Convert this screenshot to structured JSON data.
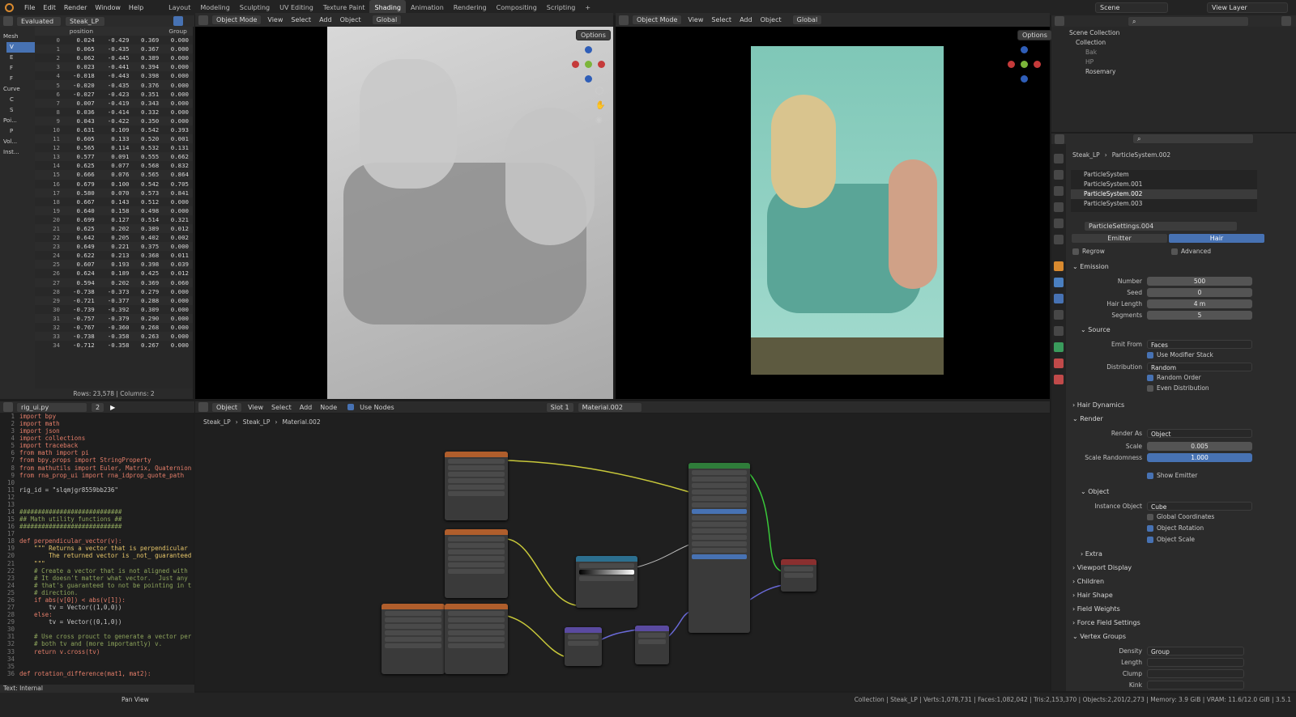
{
  "menu": [
    "File",
    "Edit",
    "Render",
    "Window",
    "Help"
  ],
  "workspaces": [
    "Layout",
    "Modeling",
    "Sculpting",
    "UV Editing",
    "Texture Paint",
    "Shading",
    "Animation",
    "Rendering",
    "Compositing",
    "Scripting",
    "+"
  ],
  "active_workspace": "Shading",
  "scene": "Scene",
  "view_layer": "View Layer",
  "spreadsheet": {
    "mode": "Evaluated",
    "object": "Steak_LP",
    "sidebar": [
      "Mesh",
      "V",
      "E",
      "F",
      "F",
      "Curve",
      "C",
      "S",
      "Poi...",
      "P",
      "Vol...",
      "Inst..."
    ],
    "columns": [
      "",
      "position",
      "",
      "",
      "Group"
    ],
    "rows": [
      [
        "0",
        "0.024",
        "-0.429",
        "0.369",
        "0.000"
      ],
      [
        "1",
        "0.065",
        "-0.435",
        "0.367",
        "0.000"
      ],
      [
        "2",
        "0.062",
        "-0.445",
        "0.389",
        "0.000"
      ],
      [
        "3",
        "0.023",
        "-0.441",
        "0.394",
        "0.000"
      ],
      [
        "4",
        "-0.018",
        "-0.443",
        "0.398",
        "0.000"
      ],
      [
        "5",
        "-0.020",
        "-0.435",
        "0.376",
        "0.000"
      ],
      [
        "6",
        "-0.027",
        "-0.423",
        "0.351",
        "0.000"
      ],
      [
        "7",
        "0.007",
        "-0.419",
        "0.343",
        "0.000"
      ],
      [
        "8",
        "0.036",
        "-0.414",
        "0.332",
        "0.000"
      ],
      [
        "9",
        "0.043",
        "-0.422",
        "0.350",
        "0.000"
      ],
      [
        "10",
        "0.631",
        "0.109",
        "0.542",
        "0.393"
      ],
      [
        "11",
        "0.605",
        "0.133",
        "0.520",
        "0.001"
      ],
      [
        "12",
        "0.565",
        "0.114",
        "0.532",
        "0.131"
      ],
      [
        "13",
        "0.577",
        "0.091",
        "0.555",
        "0.662"
      ],
      [
        "14",
        "0.625",
        "0.077",
        "0.568",
        "0.832"
      ],
      [
        "15",
        "0.666",
        "0.076",
        "0.565",
        "0.864"
      ],
      [
        "16",
        "0.679",
        "0.100",
        "0.542",
        "0.705"
      ],
      [
        "17",
        "0.580",
        "0.070",
        "0.573",
        "0.841"
      ],
      [
        "18",
        "0.667",
        "0.143",
        "0.512",
        "0.000"
      ],
      [
        "19",
        "0.640",
        "0.158",
        "0.498",
        "0.000"
      ],
      [
        "20",
        "0.699",
        "0.127",
        "0.514",
        "0.321"
      ],
      [
        "21",
        "0.625",
        "0.202",
        "0.389",
        "0.012"
      ],
      [
        "22",
        "0.642",
        "0.205",
        "0.402",
        "0.002"
      ],
      [
        "23",
        "0.649",
        "0.221",
        "0.375",
        "0.000"
      ],
      [
        "24",
        "0.622",
        "0.213",
        "0.368",
        "0.011"
      ],
      [
        "25",
        "0.607",
        "0.193",
        "0.398",
        "0.039"
      ],
      [
        "26",
        "0.624",
        "0.189",
        "0.425",
        "0.012"
      ],
      [
        "27",
        "0.594",
        "0.202",
        "0.369",
        "0.060"
      ],
      [
        "28",
        "-0.738",
        "-0.373",
        "0.279",
        "0.000"
      ],
      [
        "29",
        "-0.721",
        "-0.377",
        "0.288",
        "0.000"
      ],
      [
        "30",
        "-0.739",
        "-0.392",
        "0.309",
        "0.000"
      ],
      [
        "31",
        "-0.757",
        "-0.379",
        "0.290",
        "0.000"
      ],
      [
        "32",
        "-0.767",
        "-0.360",
        "0.268",
        "0.000"
      ],
      [
        "33",
        "-0.738",
        "-0.358",
        "0.263",
        "0.000"
      ],
      [
        "34",
        "-0.712",
        "-0.358",
        "0.267",
        "0.000"
      ]
    ],
    "footer": "Rows: 23,578  |  Columns: 2"
  },
  "viewport": {
    "mode": "Object Mode",
    "menu": [
      "View",
      "Select",
      "Add",
      "Object"
    ],
    "orientation": "Global",
    "options": "Options"
  },
  "text_editor": {
    "file": "rig_ui.py",
    "users": "2",
    "footer": "Text: Internal",
    "lines": [
      {
        "n": "1",
        "t": "import bpy"
      },
      {
        "n": "2",
        "t": "import math"
      },
      {
        "n": "3",
        "t": "import json"
      },
      {
        "n": "4",
        "t": "import collections"
      },
      {
        "n": "5",
        "t": "import traceback"
      },
      {
        "n": "6",
        "t": "from math import pi"
      },
      {
        "n": "7",
        "t": "from bpy.props import StringProperty"
      },
      {
        "n": "8",
        "t": "from mathutils import Euler, Matrix, Quaternion"
      },
      {
        "n": "9",
        "t": "from rna_prop_ui import rna_idprop_quote_path"
      },
      {
        "n": "10",
        "t": ""
      },
      {
        "n": "11",
        "t": "rig_id = \"slqmjgr8559bb236\""
      },
      {
        "n": "12",
        "t": ""
      },
      {
        "n": "13",
        "t": ""
      },
      {
        "n": "14",
        "t": "############################"
      },
      {
        "n": "15",
        "t": "## Math utility functions ##"
      },
      {
        "n": "16",
        "t": "############################"
      },
      {
        "n": "17",
        "t": ""
      },
      {
        "n": "18",
        "t": "def perpendicular_vector(v):"
      },
      {
        "n": "19",
        "t": "    \"\"\" Returns a vector that is perpendicular"
      },
      {
        "n": "20",
        "t": "        The returned vector is _not_ guaranteed"
      },
      {
        "n": "21",
        "t": "    \"\"\""
      },
      {
        "n": "22",
        "t": "    # Create a vector that is not aligned with"
      },
      {
        "n": "23",
        "t": "    # It doesn't matter what vector.  Just any"
      },
      {
        "n": "24",
        "t": "    # that's guaranteed to not be pointing in t"
      },
      {
        "n": "25",
        "t": "    # direction."
      },
      {
        "n": "26",
        "t": "    if abs(v[0]) < abs(v[1]):"
      },
      {
        "n": "27",
        "t": "        tv = Vector((1,0,0))"
      },
      {
        "n": "28",
        "t": "    else:"
      },
      {
        "n": "29",
        "t": "        tv = Vector((0,1,0))"
      },
      {
        "n": "30",
        "t": ""
      },
      {
        "n": "31",
        "t": "    # Use cross prouct to generate a vector per"
      },
      {
        "n": "32",
        "t": "    # both tv and (more importantly) v."
      },
      {
        "n": "33",
        "t": "    return v.cross(tv)"
      },
      {
        "n": "34",
        "t": ""
      },
      {
        "n": "35",
        "t": ""
      },
      {
        "n": "36",
        "t": "def rotation_difference(mat1, mat2):"
      }
    ]
  },
  "node_editor": {
    "editor_type": "Object",
    "menu": [
      "View",
      "Select",
      "Add",
      "Node"
    ],
    "use_nodes": "Use Nodes",
    "slot": "Slot 1",
    "material": "Material.002",
    "breadcrumb": [
      "Steak_LP",
      "Steak_LP",
      "Material.002"
    ]
  },
  "outliner": {
    "items": [
      "Scene Collection",
      "Collection",
      "Bak",
      "HP",
      "Rosemary"
    ]
  },
  "properties": {
    "breadcrumb": [
      "Steak_LP",
      "ParticleSystem.002"
    ],
    "systems": [
      "ParticleSystem",
      "ParticleSystem.001",
      "ParticleSystem.002",
      "ParticleSystem.003"
    ],
    "settings": "ParticleSettings.004",
    "type_emitter": "Emitter",
    "type_hair": "Hair",
    "regrow": "Regrow",
    "advanced": "Advanced",
    "emission": "Emission",
    "number_label": "Number",
    "number": "500",
    "seed_label": "Seed",
    "seed": "0",
    "hair_length_label": "Hair Length",
    "hair_length": "4 m",
    "segments_label": "Segments",
    "segments": "5",
    "source": "Source",
    "emit_from_label": "Emit From",
    "emit_from": "Faces",
    "use_modifier_stack": "Use Modifier Stack",
    "distribution_label": "Distribution",
    "distribution": "Random",
    "random_order": "Random Order",
    "even_distribution": "Even Distribution",
    "hair_dynamics": "Hair Dynamics",
    "render": "Render",
    "render_as_label": "Render As",
    "render_as": "Object",
    "scale_label": "Scale",
    "scale": "0.005",
    "scale_rand_label": "Scale Randomness",
    "scale_rand": "1.000",
    "show_emitter": "Show Emitter",
    "object": "Object",
    "instance_object_label": "Instance Object",
    "instance_object": "Cube",
    "global_coordinates": "Global Coordinates",
    "object_rotation": "Object Rotation",
    "object_scale": "Object Scale",
    "extra": "Extra",
    "panels": [
      "Viewport Display",
      "Children",
      "Hair Shape",
      "Field Weights",
      "Force Field Settings",
      "Vertex Groups"
    ],
    "vg_density_label": "Density",
    "vg_density": "Group",
    "vg_length_label": "Length",
    "vg_clump_label": "Clump",
    "vg_kink_label": "Kink"
  },
  "status": {
    "left": "Pan View",
    "right": "Collection | Steak_LP | Verts:1,078,731 | Faces:1,082,042 | Tris:2,153,370 | Objects:2,201/2,273 | Memory: 3.9 GiB | VRAM: 11.6/12.0 GiB | 3.5.1"
  }
}
